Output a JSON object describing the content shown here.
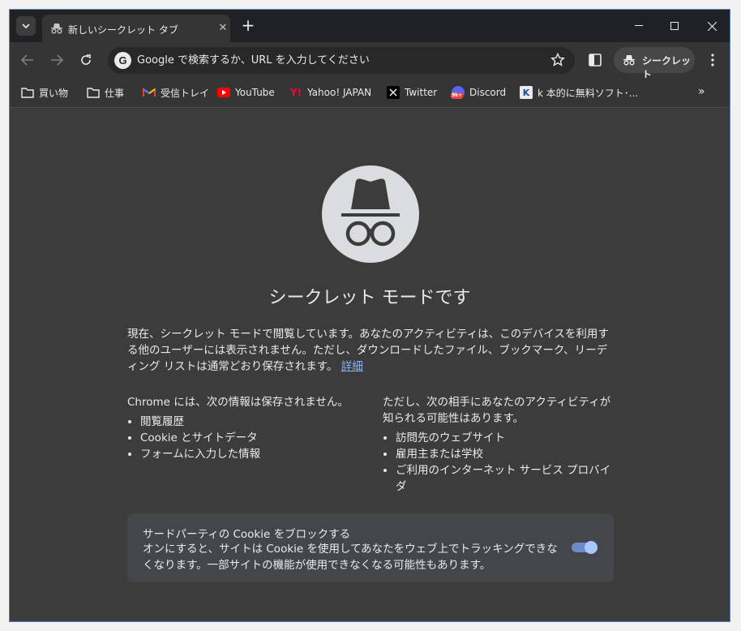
{
  "tab": {
    "title": "新しいシークレット タブ"
  },
  "omnibox": {
    "placeholder": "Google で検索するか、URL を入力してください"
  },
  "incognito_chip": {
    "label": "シークレット"
  },
  "bookmarks": [
    {
      "label": "買い物",
      "icon": "folder-icon"
    },
    {
      "label": "仕事",
      "icon": "folder-icon"
    },
    {
      "label": "受信トレイ",
      "icon": "gmail-icon"
    },
    {
      "label": "YouTube",
      "icon": "youtube-icon"
    },
    {
      "label": "Yahoo! JAPAN",
      "icon": "yahoo-icon"
    },
    {
      "label": "Twitter",
      "icon": "x-icon"
    },
    {
      "label": "Discord",
      "icon": "discord-icon"
    },
    {
      "label": "k 本的に無料ソフト･...",
      "icon": "k-icon"
    }
  ],
  "page": {
    "heading": "シークレット モードです",
    "intro": "現在、シークレット モードで閲覧しています。あなたのアクティビティは、このデバイスを利用する他のユーザーには表示されません。ただし、ダウンロードしたファイル、ブックマーク、リーディング リストは通常どおり保存されます。",
    "learn_more": "詳細",
    "not_saved_title": "Chrome には、次の情報は保存されません。",
    "not_saved_items": [
      "閲覧履歴",
      "Cookie とサイトデータ",
      "フォームに入力した情報"
    ],
    "visible_title": "ただし、次の相手にあなたのアクティビティが知られる可能性はあります。",
    "visible_items": [
      "訪問先のウェブサイト",
      "雇用主または学校",
      "ご利用のインターネット サービス プロバイダ"
    ],
    "cookie_title": "サードパーティの Cookie をブロックする",
    "cookie_desc": "オンにすると、サイトは Cookie を使用してあなたをウェブ上でトラッキングできなくなります。一部サイトの機能が使用できなくなる可能性もあります。",
    "cookie_toggle_on": true
  },
  "colors": {
    "accent": "#8ab4f8",
    "background": "#3c3c3c",
    "toggle": "#a8c7fa"
  }
}
